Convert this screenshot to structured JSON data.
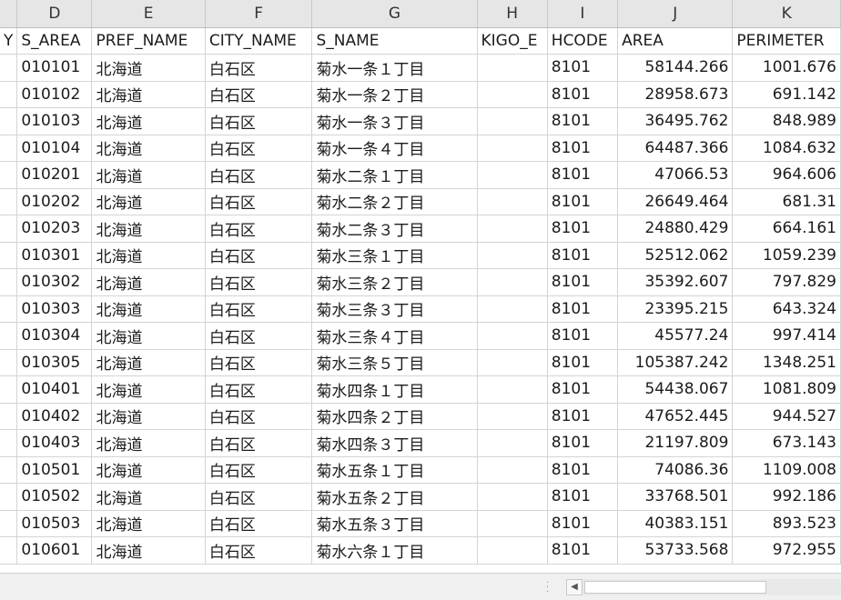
{
  "columns": [
    {
      "letter": "",
      "header": "Y"
    },
    {
      "letter": "D",
      "header": "S_AREA"
    },
    {
      "letter": "E",
      "header": "PREF_NAME"
    },
    {
      "letter": "F",
      "header": "CITY_NAME"
    },
    {
      "letter": "G",
      "header": "S_NAME"
    },
    {
      "letter": "H",
      "header": "KIGO_E"
    },
    {
      "letter": "I",
      "header": "HCODE"
    },
    {
      "letter": "J",
      "header": "AREA"
    },
    {
      "letter": "K",
      "header": "PERIMETER"
    }
  ],
  "rows": [
    {
      "s_area": "010101",
      "pref": "北海道",
      "city": "白石区",
      "s_name": "菊水一条１丁目",
      "kigo": "",
      "hcode": "8101",
      "area": "58144.266",
      "perimeter": "1001.676"
    },
    {
      "s_area": "010102",
      "pref": "北海道",
      "city": "白石区",
      "s_name": "菊水一条２丁目",
      "kigo": "",
      "hcode": "8101",
      "area": "28958.673",
      "perimeter": "691.142"
    },
    {
      "s_area": "010103",
      "pref": "北海道",
      "city": "白石区",
      "s_name": "菊水一条３丁目",
      "kigo": "",
      "hcode": "8101",
      "area": "36495.762",
      "perimeter": "848.989"
    },
    {
      "s_area": "010104",
      "pref": "北海道",
      "city": "白石区",
      "s_name": "菊水一条４丁目",
      "kigo": "",
      "hcode": "8101",
      "area": "64487.366",
      "perimeter": "1084.632"
    },
    {
      "s_area": "010201",
      "pref": "北海道",
      "city": "白石区",
      "s_name": "菊水二条１丁目",
      "kigo": "",
      "hcode": "8101",
      "area": "47066.53",
      "perimeter": "964.606"
    },
    {
      "s_area": "010202",
      "pref": "北海道",
      "city": "白石区",
      "s_name": "菊水二条２丁目",
      "kigo": "",
      "hcode": "8101",
      "area": "26649.464",
      "perimeter": "681.31"
    },
    {
      "s_area": "010203",
      "pref": "北海道",
      "city": "白石区",
      "s_name": "菊水二条３丁目",
      "kigo": "",
      "hcode": "8101",
      "area": "24880.429",
      "perimeter": "664.161"
    },
    {
      "s_area": "010301",
      "pref": "北海道",
      "city": "白石区",
      "s_name": "菊水三条１丁目",
      "kigo": "",
      "hcode": "8101",
      "area": "52512.062",
      "perimeter": "1059.239"
    },
    {
      "s_area": "010302",
      "pref": "北海道",
      "city": "白石区",
      "s_name": "菊水三条２丁目",
      "kigo": "",
      "hcode": "8101",
      "area": "35392.607",
      "perimeter": "797.829"
    },
    {
      "s_area": "010303",
      "pref": "北海道",
      "city": "白石区",
      "s_name": "菊水三条３丁目",
      "kigo": "",
      "hcode": "8101",
      "area": "23395.215",
      "perimeter": "643.324"
    },
    {
      "s_area": "010304",
      "pref": "北海道",
      "city": "白石区",
      "s_name": "菊水三条４丁目",
      "kigo": "",
      "hcode": "8101",
      "area": "45577.24",
      "perimeter": "997.414"
    },
    {
      "s_area": "010305",
      "pref": "北海道",
      "city": "白石区",
      "s_name": "菊水三条５丁目",
      "kigo": "",
      "hcode": "8101",
      "area": "105387.242",
      "perimeter": "1348.251"
    },
    {
      "s_area": "010401",
      "pref": "北海道",
      "city": "白石区",
      "s_name": "菊水四条１丁目",
      "kigo": "",
      "hcode": "8101",
      "area": "54438.067",
      "perimeter": "1081.809"
    },
    {
      "s_area": "010402",
      "pref": "北海道",
      "city": "白石区",
      "s_name": "菊水四条２丁目",
      "kigo": "",
      "hcode": "8101",
      "area": "47652.445",
      "perimeter": "944.527"
    },
    {
      "s_area": "010403",
      "pref": "北海道",
      "city": "白石区",
      "s_name": "菊水四条３丁目",
      "kigo": "",
      "hcode": "8101",
      "area": "21197.809",
      "perimeter": "673.143"
    },
    {
      "s_area": "010501",
      "pref": "北海道",
      "city": "白石区",
      "s_name": "菊水五条１丁目",
      "kigo": "",
      "hcode": "8101",
      "area": "74086.36",
      "perimeter": "1109.008"
    },
    {
      "s_area": "010502",
      "pref": "北海道",
      "city": "白石区",
      "s_name": "菊水五条２丁目",
      "kigo": "",
      "hcode": "8101",
      "area": "33768.501",
      "perimeter": "992.186"
    },
    {
      "s_area": "010503",
      "pref": "北海道",
      "city": "白石区",
      "s_name": "菊水五条３丁目",
      "kigo": "",
      "hcode": "8101",
      "area": "40383.151",
      "perimeter": "893.523"
    },
    {
      "s_area": "010601",
      "pref": "北海道",
      "city": "白石区",
      "s_name": "菊水六条１丁目",
      "kigo": "",
      "hcode": "8101",
      "area": "53733.568",
      "perimeter": "972.955"
    }
  ],
  "scrollbar": {
    "left_arrow_icon": "triangle-left-icon",
    "split_handle_icon": "vertical-dots-icon"
  }
}
